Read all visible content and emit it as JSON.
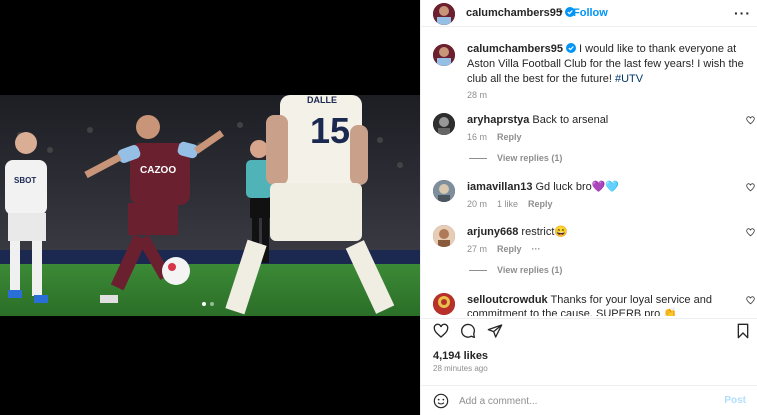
{
  "header": {
    "username": "calumchambers95",
    "separator": "•",
    "follow_label": "Follow",
    "more_label": "···"
  },
  "caption": {
    "username": "calumchambers95",
    "text": " I would like to thank everyone at Aston Villa Football Club for the last few years! I wish the club all the best for the future! ",
    "hashtag": "#UTV",
    "time": "28 m"
  },
  "comments": [
    {
      "username": "aryhaprstya",
      "text": " Back to arsenal",
      "time": "16 m",
      "likes": "",
      "reply_label": "Reply",
      "view_replies": "View replies (1)",
      "avatar_color": "#3a3a3a"
    },
    {
      "username": "iamavillan13",
      "text": " Gd luck bro💜🩵",
      "time": "20 m",
      "likes": "1 like",
      "reply_label": "Reply",
      "view_replies": "",
      "avatar_color": "#8a9aa8"
    },
    {
      "username": "arjuny668",
      "text": " restrict😄",
      "time": "27 m",
      "likes": "",
      "reply_label": "Reply",
      "extra": "···",
      "view_replies": "View replies (1)",
      "avatar_color": "#c49a7a"
    },
    {
      "username": "selloutcrowduk",
      "text": " Thanks for your loyal service and commitment to the cause. SUPERB pro 👏",
      "time": "",
      "likes": "",
      "reply_label": "",
      "view_replies": "",
      "avatar_color": "#b8302a"
    }
  ],
  "stats": {
    "likes": "4,194 likes",
    "posted": "28 minutes ago"
  },
  "composer": {
    "placeholder": "Add a comment...",
    "post_label": "Post"
  },
  "photo": {
    "player_left_shirt": "CAZOO",
    "defender_name": "DALLE",
    "defender_number": "15",
    "player_far_left_shirt": "SBOT"
  },
  "colors": {
    "accent": "#0095f6",
    "villa_claret": "#6b2030",
    "villa_blue": "#95bfe5",
    "pitch": "#2f7d2c"
  },
  "icons": [
    "verified-badge-icon",
    "more-options-icon",
    "heart-icon",
    "comment-icon",
    "share-icon",
    "bookmark-icon",
    "emoji-icon"
  ],
  "carousel": {
    "count": 2,
    "active": 1
  }
}
